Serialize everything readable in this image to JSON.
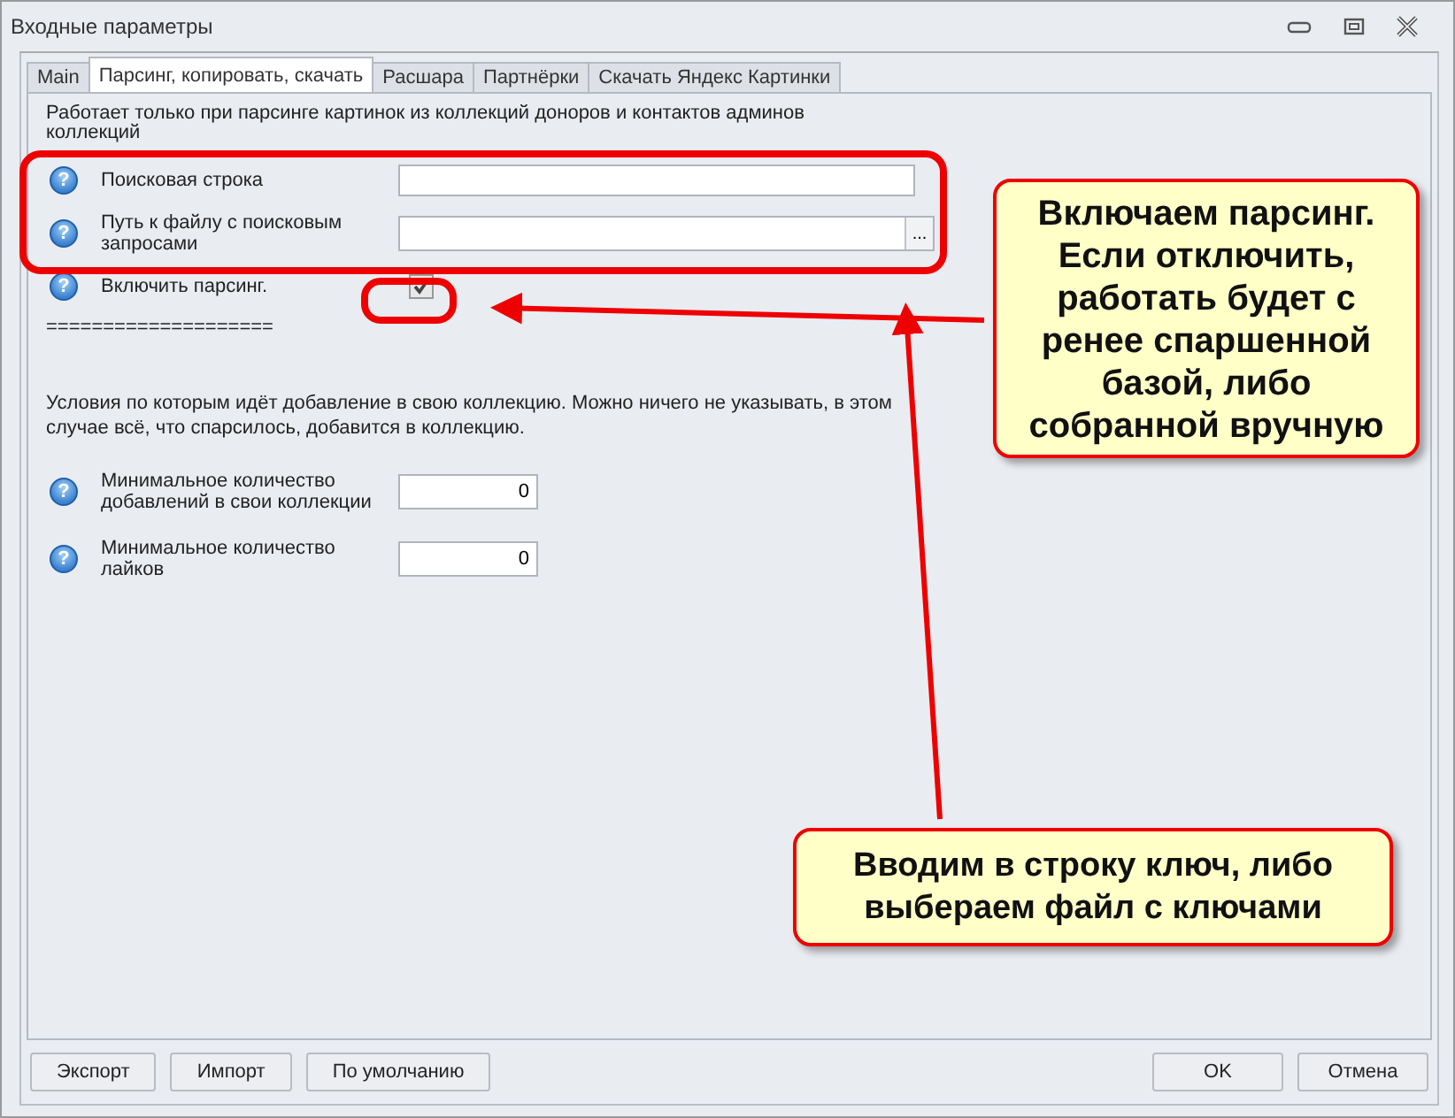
{
  "window": {
    "title": "Входные параметры"
  },
  "tabs": [
    {
      "label": "Main",
      "selected": false
    },
    {
      "label": "Парсинг, копировать, скачать",
      "selected": true
    },
    {
      "label": "Расшара",
      "selected": false
    },
    {
      "label": "Партнёрки",
      "selected": false
    },
    {
      "label": "Скачать Яндекс Картинки",
      "selected": false
    }
  ],
  "intro": "Работает только при парсинге картинок из коллекций доноров и контактов админов коллекций",
  "fields": [
    {
      "kind": "text",
      "help": "?",
      "label": "Поисковая строка"
    },
    {
      "kind": "file",
      "help": "?",
      "label": "Путь к файлу с поисковым запросами",
      "browse": "..."
    },
    {
      "kind": "checkbox",
      "help": "?",
      "label": "Включить парсинг.",
      "checked": true
    }
  ],
  "separator": "====================",
  "conditions": "Условия по которым идёт добавление в свою коллекцию. Можно ничего не указывать, в этом случае всё, что спарсилось, добавится в коллекцию.",
  "number_fields": [
    {
      "help": "?",
      "label": "Минимальное количество добавлений в свои коллекции",
      "value": "0"
    },
    {
      "help": "?",
      "label": "Минимальное количество лайков",
      "value": "0"
    }
  ],
  "buttons_left": [
    "Экспорт",
    "Импорт",
    "По умолчанию"
  ],
  "buttons_right": [
    "OK",
    "Отмена"
  ],
  "callouts": [
    "Включаем парсинг. Если отключить, работать будет с ренее спаршенной базой, либо собранной вручную",
    "Вводим в строку ключ, либо выбераем файл с ключами"
  ]
}
